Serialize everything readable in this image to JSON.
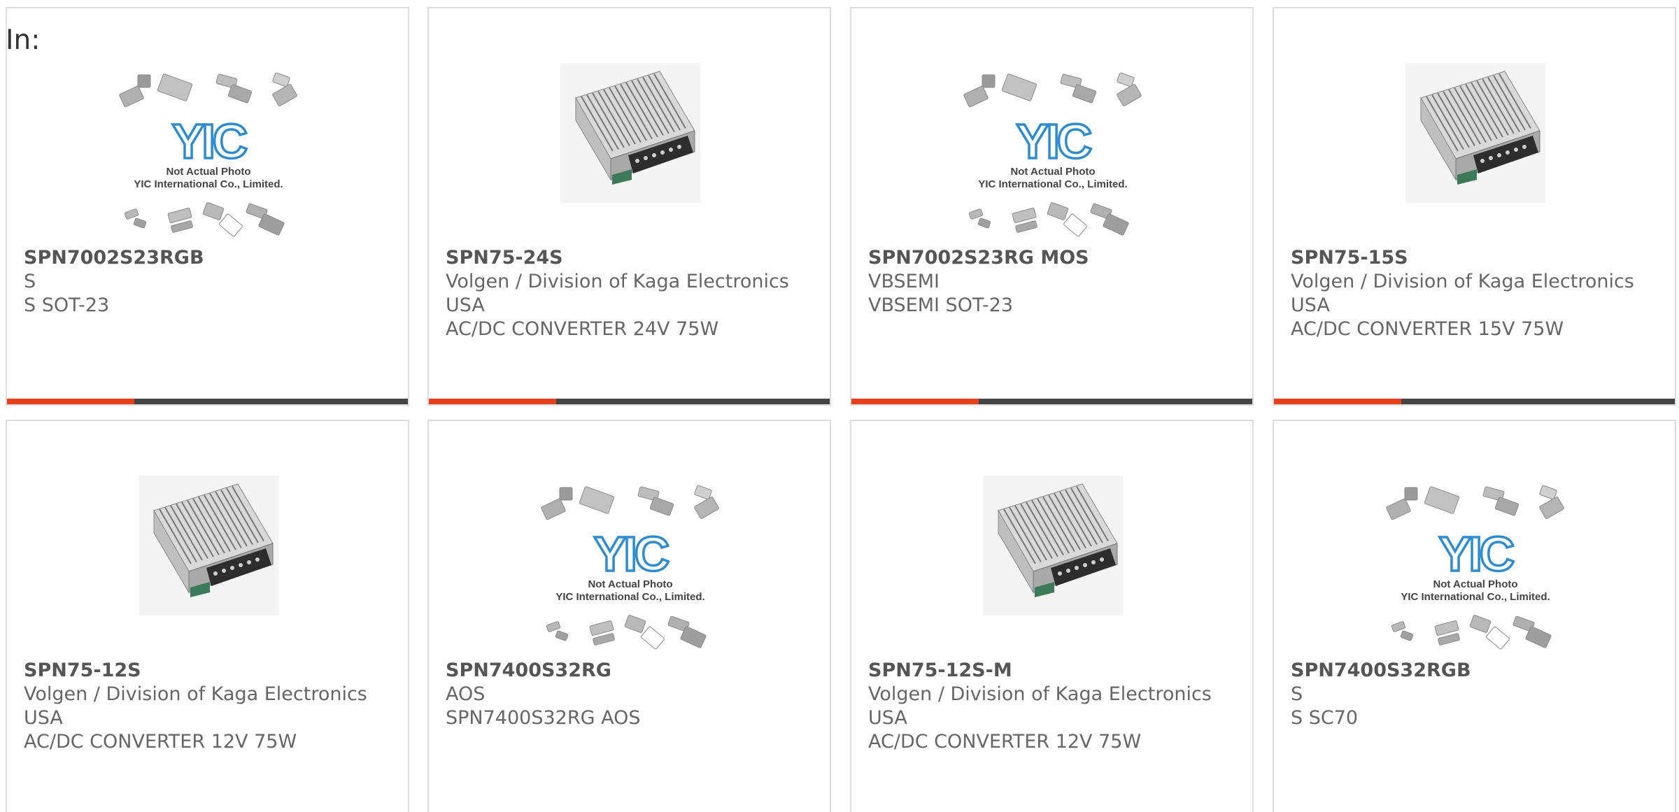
{
  "filter_label": "In:",
  "colors": {
    "accent": "#e8401c",
    "bar": "#444444",
    "card_border": "#dddddd",
    "yic_blue": "#2d8ccf"
  },
  "placeholder": {
    "line1": "Not Actual Photo",
    "line2": "YIC International Co., Limited."
  },
  "products": [
    {
      "part_number": "SPN7002S23RGB",
      "manufacturer": "S",
      "description": "S SOT-23",
      "image": "placeholder",
      "has_bar": true
    },
    {
      "part_number": "SPN75-24S",
      "manufacturer": "Volgen / Division of Kaga Electronics USA",
      "description": "AC/DC CONVERTER 24V 75W",
      "image": "power-supply",
      "has_bar": true
    },
    {
      "part_number": "SPN7002S23RG MOS",
      "manufacturer": "VBSEMI",
      "description": "VBSEMI SOT-23",
      "image": "placeholder",
      "has_bar": true
    },
    {
      "part_number": "SPN75-15S",
      "manufacturer": "Volgen / Division of Kaga Electronics USA",
      "description": "AC/DC CONVERTER 15V 75W",
      "image": "power-supply",
      "has_bar": true
    },
    {
      "part_number": "SPN75-12S",
      "manufacturer": "Volgen / Division of Kaga Electronics USA",
      "description": "AC/DC CONVERTER 12V 75W",
      "image": "power-supply",
      "has_bar": false
    },
    {
      "part_number": "SPN7400S32RG",
      "manufacturer": "AOS",
      "description": "SPN7400S32RG AOS",
      "image": "placeholder",
      "has_bar": false
    },
    {
      "part_number": "SPN75-12S-M",
      "manufacturer": "Volgen / Division of Kaga Electronics USA",
      "description": "AC/DC CONVERTER 12V 75W",
      "image": "power-supply",
      "has_bar": false
    },
    {
      "part_number": "SPN7400S32RGB",
      "manufacturer": "S",
      "description": "S SC70",
      "image": "placeholder",
      "has_bar": false
    }
  ]
}
